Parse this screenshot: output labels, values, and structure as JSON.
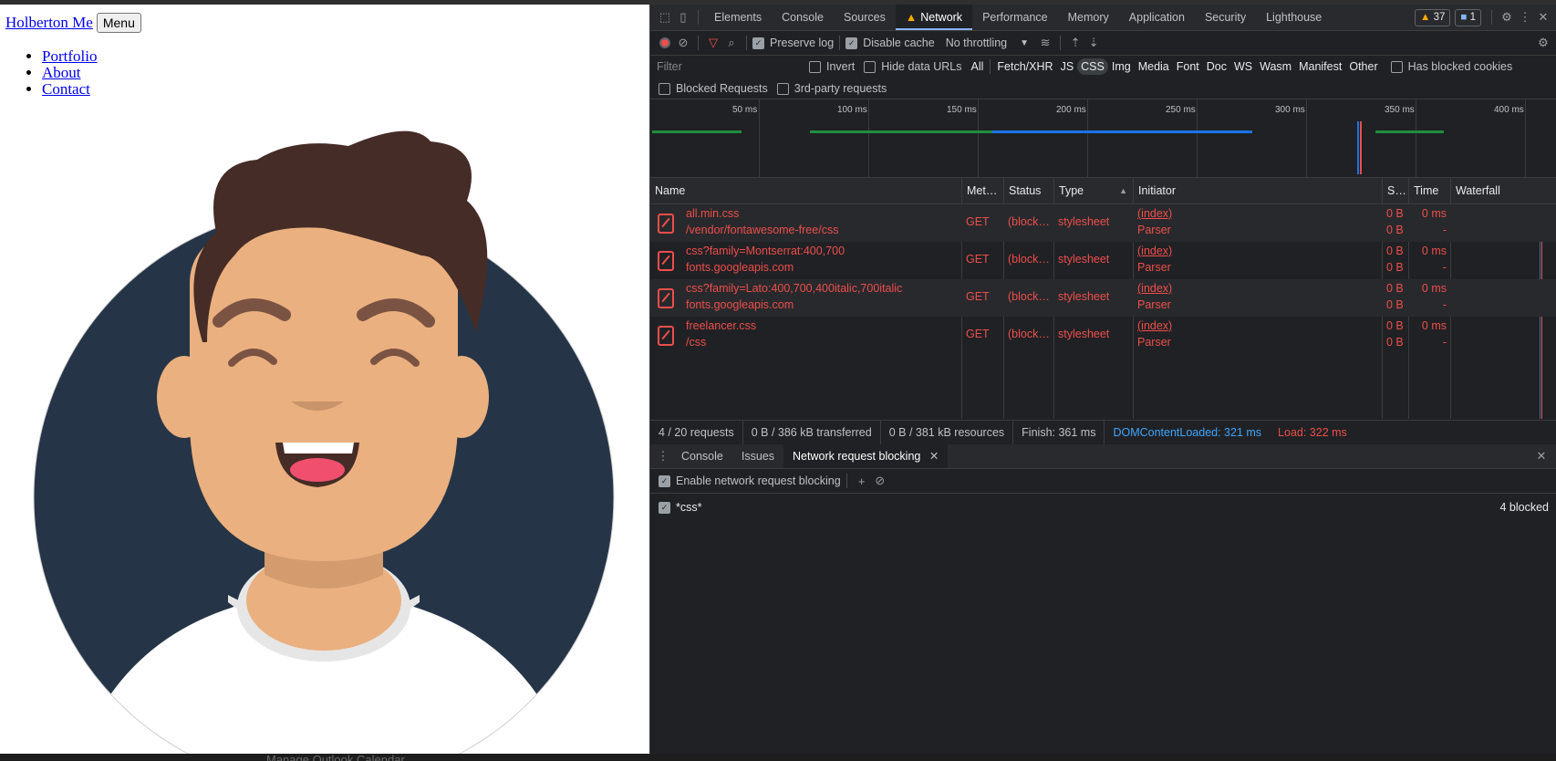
{
  "page": {
    "brand": "Holberton Me",
    "menu_button": "Menu",
    "nav": [
      "Portfolio",
      "About",
      "Contact"
    ]
  },
  "devtools": {
    "tabs": [
      "Elements",
      "Console",
      "Sources",
      "Network",
      "Performance",
      "Memory",
      "Application",
      "Security",
      "Lighthouse"
    ],
    "active_tab": "Network",
    "warnings_count": "37",
    "messages_count": "1",
    "toolbar": {
      "preserve_log": "Preserve log",
      "disable_cache": "Disable cache",
      "throttling": "No throttling"
    },
    "filter": {
      "placeholder": "Filter",
      "invert": "Invert",
      "hide_data_urls": "Hide data URLs",
      "types": [
        "All",
        "Fetch/XHR",
        "JS",
        "CSS",
        "Img",
        "Media",
        "Font",
        "Doc",
        "WS",
        "Wasm",
        "Manifest",
        "Other"
      ],
      "active_type": "CSS",
      "has_blocked_cookies": "Has blocked cookies",
      "blocked_requests": "Blocked Requests",
      "third_party": "3rd-party requests"
    },
    "timeline_ticks": [
      "50 ms",
      "100 ms",
      "150 ms",
      "200 ms",
      "250 ms",
      "300 ms",
      "350 ms",
      "400 ms"
    ],
    "columns": [
      "Name",
      "Met…",
      "Status",
      "Type",
      "Initiator",
      "S…",
      "Time",
      "Waterfall"
    ],
    "requests": [
      {
        "name": "all.min.css",
        "path": "/vendor/fontawesome-free/css",
        "method": "GET",
        "status": "(block…",
        "type": "stylesheet",
        "initiator": "(index)",
        "initiator_sub": "Parser",
        "size": "0 B",
        "size2": "0 B",
        "time": "0 ms",
        "time2": "-"
      },
      {
        "name": "css?family=Montserrat:400,700",
        "path": "fonts.googleapis.com",
        "method": "GET",
        "status": "(block…",
        "type": "stylesheet",
        "initiator": "(index)",
        "initiator_sub": "Parser",
        "size": "0 B",
        "size2": "0 B",
        "time": "0 ms",
        "time2": "-"
      },
      {
        "name": "css?family=Lato:400,700,400italic,700italic",
        "path": "fonts.googleapis.com",
        "method": "GET",
        "status": "(block…",
        "type": "stylesheet",
        "initiator": "(index)",
        "initiator_sub": "Parser",
        "size": "0 B",
        "size2": "0 B",
        "time": "0 ms",
        "time2": "-"
      },
      {
        "name": "freelancer.css",
        "path": "/css",
        "method": "GET",
        "status": "(block…",
        "type": "stylesheet",
        "initiator": "(index)",
        "initiator_sub": "Parser",
        "size": "0 B",
        "size2": "0 B",
        "time": "0 ms",
        "time2": "-"
      }
    ],
    "summary": {
      "requests": "4 / 20 requests",
      "transferred": "0 B / 386 kB transferred",
      "resources": "0 B / 381 kB resources",
      "finish": "Finish: 361 ms",
      "dcl": "DOMContentLoaded: 321 ms",
      "load": "Load: 322 ms"
    },
    "drawer": {
      "tabs": [
        "Console",
        "Issues",
        "Network request blocking"
      ],
      "active_tab": "Network request blocking",
      "enable_label": "Enable network request blocking",
      "pattern": "*css*",
      "blocked_count": "4 blocked"
    },
    "colors": {
      "error": "#ed4e4c",
      "accent": "#8ab4f8",
      "dcl": "#3ea6ff",
      "warning": "#f9ab00"
    }
  },
  "background": {
    "bottom_text": "Manage Outlook Calendar"
  }
}
